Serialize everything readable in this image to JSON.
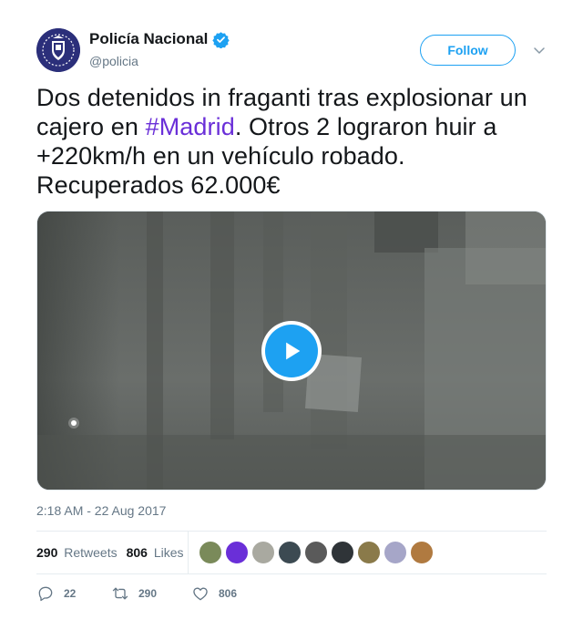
{
  "account": {
    "display_name": "Policía Nacional",
    "handle": "@policia",
    "verified": true,
    "avatar_color": "#2b2f7a"
  },
  "follow_button": {
    "label": "Follow",
    "color": "#1da1f2"
  },
  "tweet": {
    "text_before": "Dos detenidos in fraganti tras explosionar un cajero en ",
    "hashtag": "#Madrid",
    "text_after": ". Otros 2 lograron huir a +220km/h en un vehículo robado. Recuperados 62.000€",
    "hashtag_color": "#6a2fd8"
  },
  "media": {
    "type": "video",
    "play_icon": "play-icon"
  },
  "timestamp": "2:18 AM - 22 Aug 2017",
  "stats": {
    "retweets_count": "290",
    "retweets_label": "Retweets",
    "likes_count": "806",
    "likes_label": "Likes",
    "liker_avatar_colors": [
      "#7a8a5a",
      "#6a2fd8",
      "#a9a9a0",
      "#3c4a52",
      "#5a5a5a",
      "#2f3438",
      "#8a7a4a",
      "#a6a6c8",
      "#b07a40"
    ]
  },
  "actions": {
    "reply_count": "22",
    "retweet_count": "290",
    "like_count": "806"
  }
}
